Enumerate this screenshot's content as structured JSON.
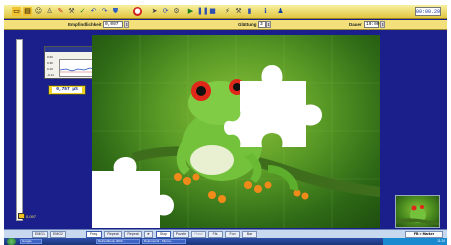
{
  "toolbar": {
    "time": "00:00.29"
  },
  "params": {
    "sensitivity_label": "Empfindlichkeit",
    "sensitivity_value": "0,097",
    "smoothing_label": "Glättung",
    "smoothing_value": "3",
    "duration_label": "Dauer",
    "duration_value": "10:00"
  },
  "sensor": {
    "title": "",
    "ticks": [
      "0.60",
      "0.36",
      "0.10",
      "-0.14"
    ],
    "reading": "0,757",
    "unit": "µS",
    "level_text": "0.097"
  },
  "controls": {
    "buttons": [
      "EMG1",
      "EMG2",
      "Freq.",
      "Repeat",
      "Repeat",
      "",
      "Stop",
      "Puzzle",
      "Flash",
      "Flk.",
      "Fon",
      "Bar"
    ],
    "fb_label": "FB > Marker"
  },
  "taskbar": {
    "start_label": "Google",
    "tasks": [
      "Refreshbook 3000 ...",
      "Dokument1 - Micros..."
    ],
    "tray_time": "11:24"
  },
  "colors": {
    "app_background": "#1a1f8c",
    "toolbar_yellow": "#e8cf4a",
    "puzzle_green": "#5a9a26",
    "frog_body": "#74c23c",
    "frog_eye": "#e0281a",
    "frog_feet": "#f28a1a"
  }
}
